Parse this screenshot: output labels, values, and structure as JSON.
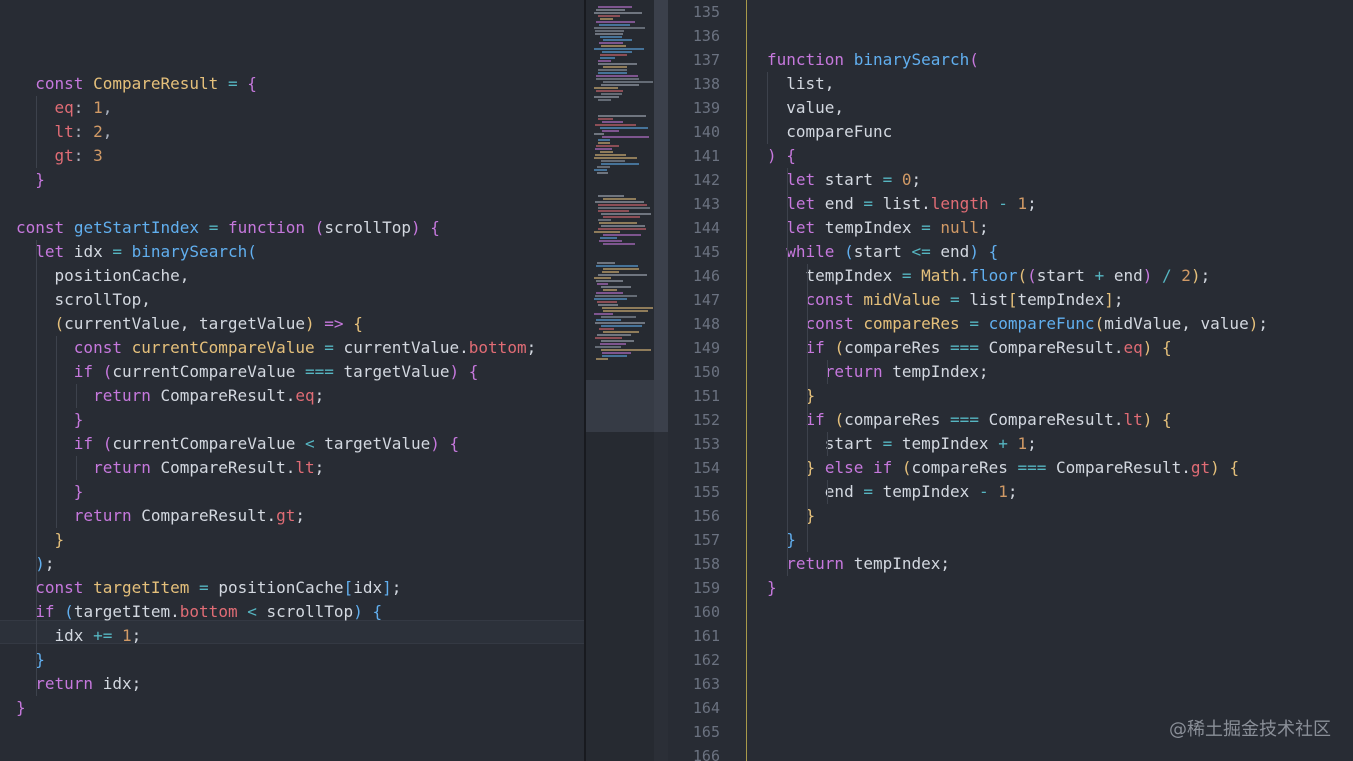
{
  "left_editor": {
    "lines": [
      [],
      [],
      [],
      [
        {
          "t": "  "
        },
        {
          "t": "const",
          "c": "kw"
        },
        {
          "t": " "
        },
        {
          "t": "CompareResult",
          "c": "cls"
        },
        {
          "t": " "
        },
        {
          "t": "=",
          "c": "op"
        },
        {
          "t": " "
        },
        {
          "t": "{",
          "c": "b2"
        }
      ],
      [
        {
          "t": "    "
        },
        {
          "t": "eq",
          "c": "prop"
        },
        {
          "t": ": ",
          "c": "pun"
        },
        {
          "t": "1",
          "c": "num"
        },
        {
          "t": ",",
          "c": "pun"
        }
      ],
      [
        {
          "t": "    "
        },
        {
          "t": "lt",
          "c": "prop"
        },
        {
          "t": ": ",
          "c": "pun"
        },
        {
          "t": "2",
          "c": "num"
        },
        {
          "t": ",",
          "c": "pun"
        }
      ],
      [
        {
          "t": "    "
        },
        {
          "t": "gt",
          "c": "prop"
        },
        {
          "t": ": ",
          "c": "pun"
        },
        {
          "t": "3",
          "c": "num"
        }
      ],
      [
        {
          "t": "  "
        },
        {
          "t": "}",
          "c": "b2"
        }
      ],
      [],
      [
        {
          "t": "const",
          "c": "kw"
        },
        {
          "t": " "
        },
        {
          "t": "getStartIndex",
          "c": "fn"
        },
        {
          "t": " "
        },
        {
          "t": "=",
          "c": "op"
        },
        {
          "t": " "
        },
        {
          "t": "function",
          "c": "kw"
        },
        {
          "t": " "
        },
        {
          "t": "(",
          "c": "b2"
        },
        {
          "t": "scrollTop"
        },
        {
          "t": ")",
          "c": "b2"
        },
        {
          "t": " "
        },
        {
          "t": "{",
          "c": "b2"
        }
      ],
      [
        {
          "t": "  "
        },
        {
          "t": "let",
          "c": "kw"
        },
        {
          "t": " idx "
        },
        {
          "t": "=",
          "c": "op"
        },
        {
          "t": " "
        },
        {
          "t": "binarySearch",
          "c": "fn"
        },
        {
          "t": "(",
          "c": "b3"
        }
      ],
      [
        {
          "t": "    positionCache,"
        }
      ],
      [
        {
          "t": "    scrollTop,"
        }
      ],
      [
        {
          "t": "    "
        },
        {
          "t": "(",
          "c": "b1"
        },
        {
          "t": "currentValue, targetValue"
        },
        {
          "t": ")",
          "c": "b1"
        },
        {
          "t": " "
        },
        {
          "t": "=>",
          "c": "kw"
        },
        {
          "t": " "
        },
        {
          "t": "{",
          "c": "b1"
        }
      ],
      [
        {
          "t": "      "
        },
        {
          "t": "const",
          "c": "kw"
        },
        {
          "t": " "
        },
        {
          "t": "currentCompareValue",
          "c": "cls"
        },
        {
          "t": " "
        },
        {
          "t": "=",
          "c": "op"
        },
        {
          "t": " currentValue."
        },
        {
          "t": "bottom",
          "c": "prop"
        },
        {
          "t": ";"
        }
      ],
      [
        {
          "t": "      "
        },
        {
          "t": "if",
          "c": "kw"
        },
        {
          "t": " "
        },
        {
          "t": "(",
          "c": "b2"
        },
        {
          "t": "currentCompareValue "
        },
        {
          "t": "===",
          "c": "op"
        },
        {
          "t": " targetValue"
        },
        {
          "t": ")",
          "c": "b2"
        },
        {
          "t": " "
        },
        {
          "t": "{",
          "c": "b2"
        }
      ],
      [
        {
          "t": "        "
        },
        {
          "t": "return",
          "c": "kw"
        },
        {
          "t": " CompareResult."
        },
        {
          "t": "eq",
          "c": "prop"
        },
        {
          "t": ";"
        }
      ],
      [
        {
          "t": "      "
        },
        {
          "t": "}",
          "c": "b2"
        }
      ],
      [
        {
          "t": "      "
        },
        {
          "t": "if",
          "c": "kw"
        },
        {
          "t": " "
        },
        {
          "t": "(",
          "c": "b2"
        },
        {
          "t": "currentCompareValue "
        },
        {
          "t": "<",
          "c": "op"
        },
        {
          "t": " targetValue"
        },
        {
          "t": ")",
          "c": "b2"
        },
        {
          "t": " "
        },
        {
          "t": "{",
          "c": "b2"
        }
      ],
      [
        {
          "t": "        "
        },
        {
          "t": "return",
          "c": "kw"
        },
        {
          "t": " CompareResult."
        },
        {
          "t": "lt",
          "c": "prop"
        },
        {
          "t": ";"
        }
      ],
      [
        {
          "t": "      "
        },
        {
          "t": "}",
          "c": "b2"
        }
      ],
      [
        {
          "t": "      "
        },
        {
          "t": "return",
          "c": "kw"
        },
        {
          "t": " CompareResult."
        },
        {
          "t": "gt",
          "c": "prop"
        },
        {
          "t": ";"
        }
      ],
      [
        {
          "t": "    "
        },
        {
          "t": "}",
          "c": "b1"
        }
      ],
      [
        {
          "t": "  "
        },
        {
          "t": ")",
          "c": "b3"
        },
        {
          "t": ";"
        }
      ],
      [
        {
          "t": "  "
        },
        {
          "t": "const",
          "c": "kw"
        },
        {
          "t": " "
        },
        {
          "t": "targetItem",
          "c": "cls"
        },
        {
          "t": " "
        },
        {
          "t": "=",
          "c": "op"
        },
        {
          "t": " positionCache"
        },
        {
          "t": "[",
          "c": "b3"
        },
        {
          "t": "idx"
        },
        {
          "t": "]",
          "c": "b3"
        },
        {
          "t": ";"
        }
      ],
      [
        {
          "t": "  "
        },
        {
          "t": "if",
          "c": "kw"
        },
        {
          "t": " "
        },
        {
          "t": "(",
          "c": "b3"
        },
        {
          "t": "targetItem."
        },
        {
          "t": "bottom",
          "c": "prop"
        },
        {
          "t": " "
        },
        {
          "t": "<",
          "c": "op"
        },
        {
          "t": " scrollTop"
        },
        {
          "t": ")",
          "c": "b3"
        },
        {
          "t": " "
        },
        {
          "t": "{",
          "c": "b3"
        }
      ],
      [
        {
          "t": "    idx "
        },
        {
          "t": "+=",
          "c": "op"
        },
        {
          "t": " "
        },
        {
          "t": "1",
          "c": "num"
        },
        {
          "t": ";"
        }
      ],
      [
        {
          "t": "  "
        },
        {
          "t": "}",
          "c": "b3"
        }
      ],
      [
        {
          "t": "  "
        },
        {
          "t": "return",
          "c": "kw"
        },
        {
          "t": " idx;"
        }
      ],
      [
        {
          "t": "}",
          "c": "b2"
        }
      ]
    ]
  },
  "right_editor": {
    "line_numbers": [
      "135",
      "136",
      "137",
      "138",
      "139",
      "140",
      "141",
      "142",
      "143",
      "144",
      "145",
      "146",
      "147",
      "148",
      "149",
      "150",
      "151",
      "152",
      "153",
      "154",
      "155",
      "156",
      "157",
      "158",
      "159",
      "160",
      "161",
      "162",
      "163",
      "164",
      "165",
      "166"
    ],
    "lines": [
      [],
      [],
      [
        {
          "t": "function",
          "c": "kw"
        },
        {
          "t": " "
        },
        {
          "t": "binarySearch",
          "c": "fn"
        },
        {
          "t": "(",
          "c": "b2"
        }
      ],
      [
        {
          "t": "  list,"
        }
      ],
      [
        {
          "t": "  value,"
        }
      ],
      [
        {
          "t": "  compareFunc"
        }
      ],
      [
        {
          "t": ")",
          "c": "b2"
        },
        {
          "t": " "
        },
        {
          "t": "{",
          "c": "b2"
        }
      ],
      [
        {
          "t": "  "
        },
        {
          "t": "let",
          "c": "kw"
        },
        {
          "t": " start "
        },
        {
          "t": "=",
          "c": "op"
        },
        {
          "t": " "
        },
        {
          "t": "0",
          "c": "num"
        },
        {
          "t": ";"
        }
      ],
      [
        {
          "t": "  "
        },
        {
          "t": "let",
          "c": "kw"
        },
        {
          "t": " end "
        },
        {
          "t": "=",
          "c": "op"
        },
        {
          "t": " list."
        },
        {
          "t": "length",
          "c": "prop"
        },
        {
          "t": " "
        },
        {
          "t": "-",
          "c": "op"
        },
        {
          "t": " "
        },
        {
          "t": "1",
          "c": "num"
        },
        {
          "t": ";"
        }
      ],
      [
        {
          "t": "  "
        },
        {
          "t": "let",
          "c": "kw"
        },
        {
          "t": " tempIndex "
        },
        {
          "t": "=",
          "c": "op"
        },
        {
          "t": " "
        },
        {
          "t": "null",
          "c": "num"
        },
        {
          "t": ";"
        }
      ],
      [
        {
          "t": "  "
        },
        {
          "t": "while",
          "c": "kw"
        },
        {
          "t": " "
        },
        {
          "t": "(",
          "c": "b3"
        },
        {
          "t": "start "
        },
        {
          "t": "<=",
          "c": "op"
        },
        {
          "t": " end"
        },
        {
          "t": ")",
          "c": "b3"
        },
        {
          "t": " "
        },
        {
          "t": "{",
          "c": "b3"
        }
      ],
      [
        {
          "t": "    tempIndex "
        },
        {
          "t": "=",
          "c": "op"
        },
        {
          "t": " "
        },
        {
          "t": "Math",
          "c": "cls"
        },
        {
          "t": "."
        },
        {
          "t": "floor",
          "c": "fn"
        },
        {
          "t": "(",
          "c": "b1"
        },
        {
          "t": "(",
          "c": "b2"
        },
        {
          "t": "start "
        },
        {
          "t": "+",
          "c": "op"
        },
        {
          "t": " end"
        },
        {
          "t": ")",
          "c": "b2"
        },
        {
          "t": " "
        },
        {
          "t": "/",
          "c": "op"
        },
        {
          "t": " "
        },
        {
          "t": "2",
          "c": "num"
        },
        {
          "t": ")",
          "c": "b1"
        },
        {
          "t": ";"
        }
      ],
      [
        {
          "t": "    "
        },
        {
          "t": "const",
          "c": "kw"
        },
        {
          "t": " "
        },
        {
          "t": "midValue",
          "c": "cls"
        },
        {
          "t": " "
        },
        {
          "t": "=",
          "c": "op"
        },
        {
          "t": " list"
        },
        {
          "t": "[",
          "c": "b1"
        },
        {
          "t": "tempIndex"
        },
        {
          "t": "]",
          "c": "b1"
        },
        {
          "t": ";"
        }
      ],
      [
        {
          "t": "    "
        },
        {
          "t": "const",
          "c": "kw"
        },
        {
          "t": " "
        },
        {
          "t": "compareRes",
          "c": "cls"
        },
        {
          "t": " "
        },
        {
          "t": "=",
          "c": "op"
        },
        {
          "t": " "
        },
        {
          "t": "compareFunc",
          "c": "fn"
        },
        {
          "t": "(",
          "c": "b1"
        },
        {
          "t": "midValue, value"
        },
        {
          "t": ")",
          "c": "b1"
        },
        {
          "t": ";"
        }
      ],
      [
        {
          "t": "    "
        },
        {
          "t": "if",
          "c": "kw"
        },
        {
          "t": " "
        },
        {
          "t": "(",
          "c": "b1"
        },
        {
          "t": "compareRes "
        },
        {
          "t": "===",
          "c": "op"
        },
        {
          "t": " CompareResult."
        },
        {
          "t": "eq",
          "c": "prop"
        },
        {
          "t": ")",
          "c": "b1"
        },
        {
          "t": " "
        },
        {
          "t": "{",
          "c": "b1"
        }
      ],
      [
        {
          "t": "      "
        },
        {
          "t": "return",
          "c": "kw"
        },
        {
          "t": " tempIndex;"
        }
      ],
      [
        {
          "t": "    "
        },
        {
          "t": "}",
          "c": "b1"
        }
      ],
      [
        {
          "t": "    "
        },
        {
          "t": "if",
          "c": "kw"
        },
        {
          "t": " "
        },
        {
          "t": "(",
          "c": "b1"
        },
        {
          "t": "compareRes "
        },
        {
          "t": "===",
          "c": "op"
        },
        {
          "t": " CompareResult."
        },
        {
          "t": "lt",
          "c": "prop"
        },
        {
          "t": ")",
          "c": "b1"
        },
        {
          "t": " "
        },
        {
          "t": "{",
          "c": "b1"
        }
      ],
      [
        {
          "t": "      start "
        },
        {
          "t": "=",
          "c": "op"
        },
        {
          "t": " tempIndex "
        },
        {
          "t": "+",
          "c": "op"
        },
        {
          "t": " "
        },
        {
          "t": "1",
          "c": "num"
        },
        {
          "t": ";"
        }
      ],
      [
        {
          "t": "    "
        },
        {
          "t": "}",
          "c": "b1"
        },
        {
          "t": " "
        },
        {
          "t": "else",
          "c": "kw"
        },
        {
          "t": " "
        },
        {
          "t": "if",
          "c": "kw"
        },
        {
          "t": " "
        },
        {
          "t": "(",
          "c": "b1"
        },
        {
          "t": "compareRes "
        },
        {
          "t": "===",
          "c": "op"
        },
        {
          "t": " CompareResult."
        },
        {
          "t": "gt",
          "c": "prop"
        },
        {
          "t": ")",
          "c": "b1"
        },
        {
          "t": " "
        },
        {
          "t": "{",
          "c": "b1"
        }
      ],
      [
        {
          "t": "      end "
        },
        {
          "t": "=",
          "c": "op"
        },
        {
          "t": " tempIndex "
        },
        {
          "t": "-",
          "c": "op"
        },
        {
          "t": " "
        },
        {
          "t": "1",
          "c": "num"
        },
        {
          "t": ";"
        }
      ],
      [
        {
          "t": "    "
        },
        {
          "t": "}",
          "c": "b1"
        }
      ],
      [
        {
          "t": "  "
        },
        {
          "t": "}",
          "c": "b3"
        }
      ],
      [
        {
          "t": "  "
        },
        {
          "t": "return",
          "c": "kw"
        },
        {
          "t": " tempIndex;"
        }
      ],
      [
        {
          "t": "}",
          "c": "b2"
        }
      ],
      [],
      [],
      [],
      [],
      [],
      [],
      []
    ]
  },
  "watermark": "@稀土掘金技术社区",
  "colors": {
    "background": "#282c34",
    "keyword": "#c678dd",
    "function": "#61afef",
    "class": "#e5c07b",
    "property": "#e06c75",
    "number": "#d19a66",
    "operator": "#56b6c2"
  }
}
